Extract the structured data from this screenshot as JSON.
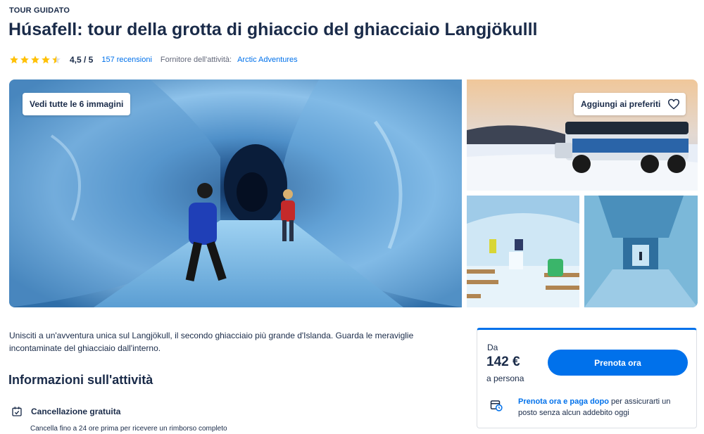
{
  "header": {
    "eyebrow": "TOUR GUIDATO",
    "title": "Húsafell: tour della grotta di ghiaccio del ghiacciaio Langjökulll"
  },
  "rating": {
    "value": 4.5,
    "score_text": "4,5 / 5",
    "reviews_link": "157 recensioni",
    "provider_label": "Fornitore dell'attività:",
    "provider_name": "Arctic Adventures",
    "star_color": "#ffc107"
  },
  "gallery": {
    "view_all_label": "Vedi tutte le 6 immagini",
    "wishlist_label": "Aggiungi ai preferiti"
  },
  "description": "Unisciti a un'avventura unica sul Langjökull, il secondo ghiacciaio più grande d'Islanda. Guarda le meraviglie incontaminate del ghiacciaio dall'interno.",
  "about": {
    "title": "Informazioni sull'attività",
    "features": [
      {
        "icon": "calendar-check-icon",
        "label": "Cancellazione gratuita",
        "sub": "Cancella fino a 24 ore prima per ricevere un rimborso completo"
      }
    ]
  },
  "booking": {
    "from_label": "Da",
    "price": "142 €",
    "per_label": "a persona",
    "cta_label": "Prenota ora",
    "reserve_link": "Prenota ora e paga dopo",
    "reserve_text": " per assicurarti un posto senza alcun addebito oggi",
    "accent_color": "#0071eb"
  }
}
